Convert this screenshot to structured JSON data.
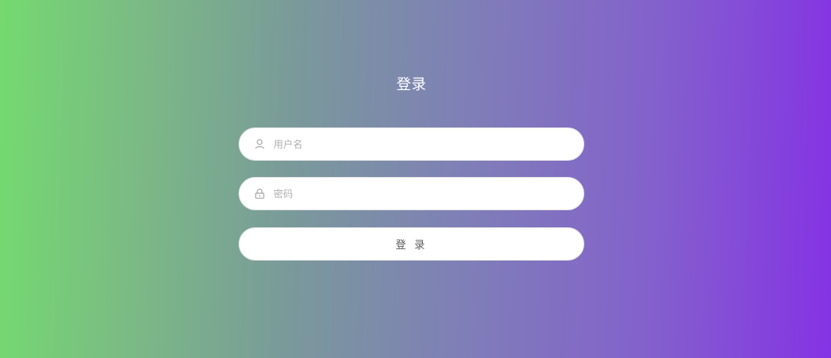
{
  "login": {
    "title": "登录",
    "username": {
      "icon": "user-icon",
      "placeholder": "用户名",
      "value": ""
    },
    "password": {
      "icon": "lock-icon",
      "placeholder": "密码",
      "value": ""
    },
    "submit_label": "登 录"
  },
  "colors": {
    "gradient_start": "#74da70",
    "gradient_end": "#8533e4",
    "field_background": "#ffffff",
    "title_text": "#ffffff",
    "placeholder_text": "#b0b0b0"
  }
}
